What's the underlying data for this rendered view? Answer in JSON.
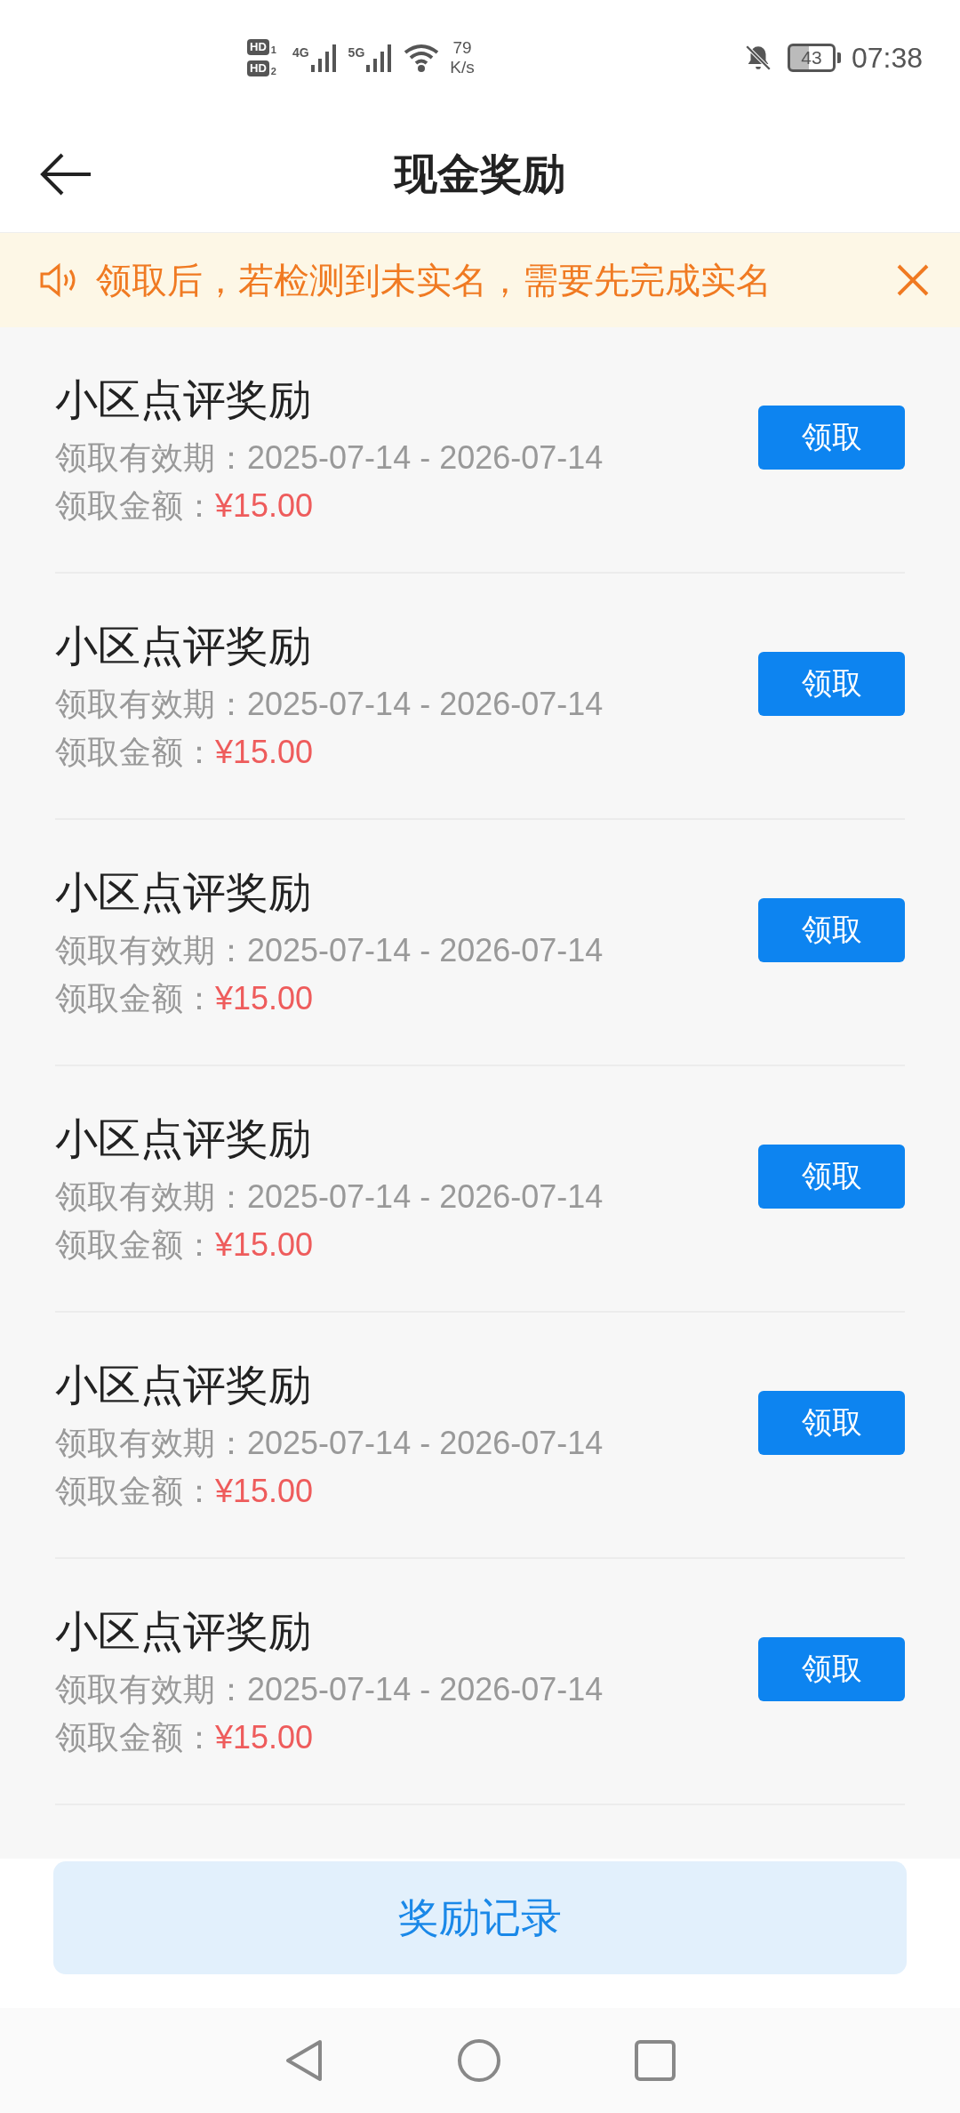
{
  "status_bar": {
    "sims": [
      {
        "label": "HD",
        "index": "1"
      },
      {
        "label": "HD",
        "index": "2"
      }
    ],
    "networks": [
      "4G",
      "5G"
    ],
    "speed_value": "79",
    "speed_unit": "K/s",
    "battery": "43",
    "time": "07:38"
  },
  "header": {
    "title": "现金奖励"
  },
  "notice": {
    "text": "领取后，若检测到未实名，需要先完成实名"
  },
  "rewards": [
    {
      "title": "小区点评奖励",
      "period_label": "领取有效期：",
      "period": "2025-07-14 - 2026-07-14",
      "amount_label": "领取金额：",
      "amount": "¥15.00",
      "button": "领取"
    },
    {
      "title": "小区点评奖励",
      "period_label": "领取有效期：",
      "period": "2025-07-14 - 2026-07-14",
      "amount_label": "领取金额：",
      "amount": "¥15.00",
      "button": "领取"
    },
    {
      "title": "小区点评奖励",
      "period_label": "领取有效期：",
      "period": "2025-07-14 - 2026-07-14",
      "amount_label": "领取金额：",
      "amount": "¥15.00",
      "button": "领取"
    },
    {
      "title": "小区点评奖励",
      "period_label": "领取有效期：",
      "period": "2025-07-14 - 2026-07-14",
      "amount_label": "领取金额：",
      "amount": "¥15.00",
      "button": "领取"
    },
    {
      "title": "小区点评奖励",
      "period_label": "领取有效期：",
      "period": "2025-07-14 - 2026-07-14",
      "amount_label": "领取金额：",
      "amount": "¥15.00",
      "button": "领取"
    },
    {
      "title": "小区点评奖励",
      "period_label": "领取有效期：",
      "period": "2025-07-14 - 2026-07-14",
      "amount_label": "领取金额：",
      "amount": "¥15.00",
      "button": "领取"
    }
  ],
  "footer": {
    "button": "奖励记录"
  }
}
